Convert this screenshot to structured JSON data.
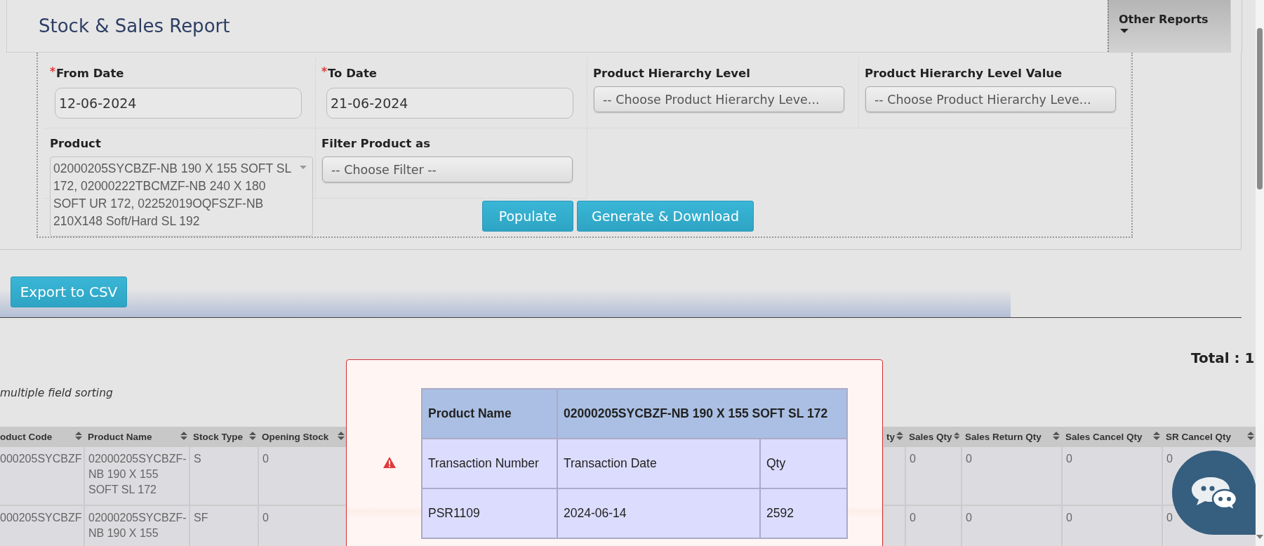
{
  "header": {
    "title": "Stock & Sales Report",
    "other_reports": "Other Reports"
  },
  "filters": [
    {
      "kind": "date",
      "label": "From Date",
      "required": true,
      "value": "12-06-2024"
    },
    {
      "kind": "date",
      "label": "To Date",
      "required": true,
      "value": "21-06-2024"
    },
    {
      "kind": "select",
      "label": "Product Hierarchy Level",
      "required": false,
      "placeholder": "-- Choose Product Hierarchy Leve..."
    },
    {
      "kind": "select",
      "label": "Product Hierarchy Level Value",
      "required": false,
      "placeholder": "-- Choose Product Hierarchy Leve..."
    },
    {
      "kind": "multiselect",
      "label": "Product",
      "required": false,
      "value": "02000205SYCBZF-NB 190 X 155 SOFT SL 172, 02000222TBCMZF-NB 240 X 180 SOFT UR 172, 02252019OQFSZF-NB 210X148 Soft/Hard SL 192"
    },
    {
      "kind": "select",
      "label": "Filter Product as",
      "required": false,
      "placeholder": "-- Choose Filter --"
    }
  ],
  "buttons": [
    "Populate",
    "Generate & Download"
  ],
  "export_button": "Export to CSV",
  "total": "Total : 1",
  "sort_hint": "multiple field sorting",
  "table": {
    "columns": [
      "oduct Code",
      "Product Name",
      "Stock Type",
      "Opening Stock",
      null,
      "ty",
      "Sales Qty",
      "Sales Return Qty",
      "Sales Cancel Qty",
      "SR Cancel Qty"
    ],
    "rows": [
      [
        "000205SYCBZF",
        "02000205SYCBZF-NB 190 X 155 SOFT SL 172",
        "S",
        "0",
        null,
        null,
        "0",
        "0",
        "0",
        "0"
      ],
      [
        "000205SYCBZF",
        "02000205SYCBZF-NB 190 X 155",
        "SF",
        "0",
        null,
        null,
        "0",
        "0",
        "0",
        "0"
      ]
    ]
  },
  "popup": {
    "header": [
      "Product Name",
      "02000205SYCBZF-NB 190 X 155 SOFT SL 172"
    ],
    "columns": [
      "Transaction Number",
      "Transaction Date",
      "Qty"
    ],
    "rows": [
      [
        "PSR1109",
        "2024-06-14",
        "2592"
      ]
    ]
  }
}
